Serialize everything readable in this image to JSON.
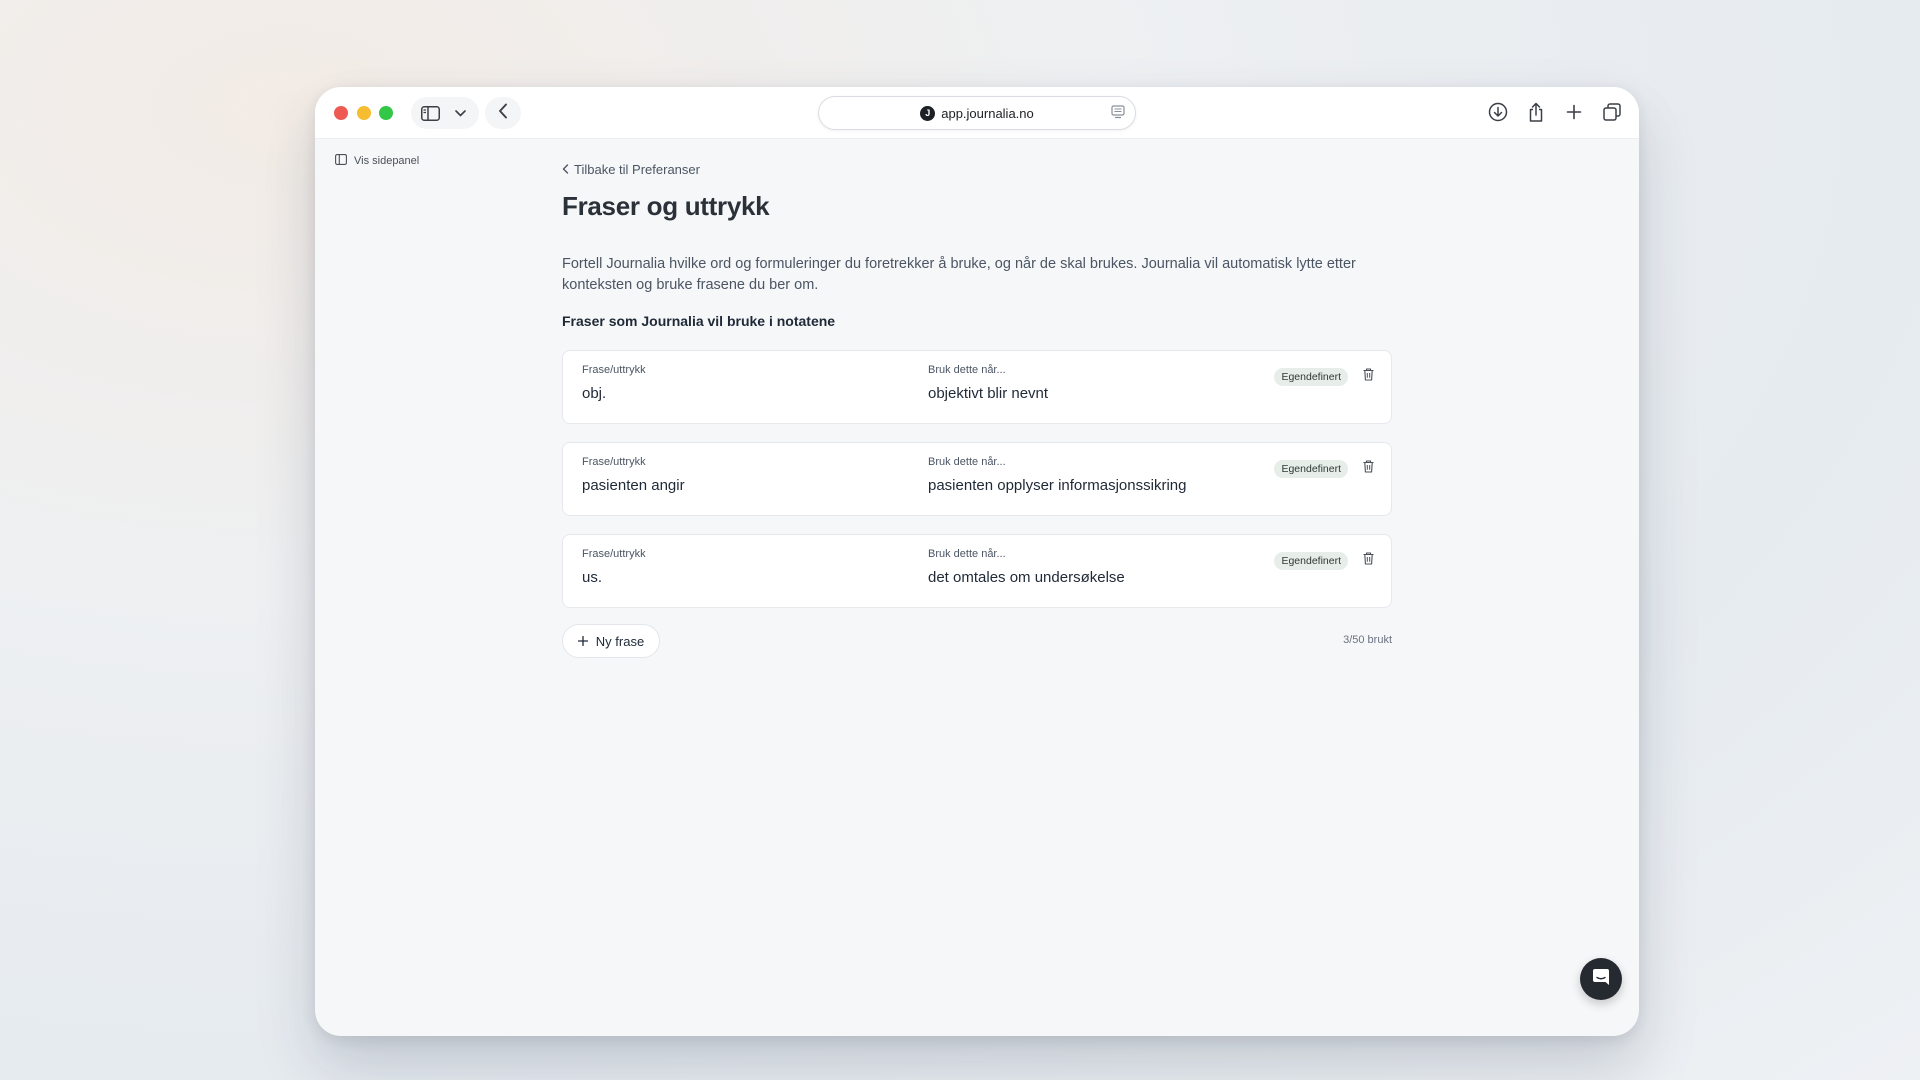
{
  "browser": {
    "url": "app.journalia.no",
    "favicon_letter": "J"
  },
  "sidebar_toggle": {
    "label": "Vis sidepanel"
  },
  "page": {
    "back_label": "Tilbake til Preferanser",
    "title": "Fraser og uttrykk",
    "description": "Fortell Journalia hvilke ord og formuleringer du foretrekker å bruke, og når de skal brukes. Journalia vil automatisk lytte etter konteksten og bruke frasene du ber om.",
    "section_heading": "Fraser som Journalia vil bruke i notatene"
  },
  "phrases": [
    {
      "phrase_label": "Frase/uttrykk",
      "phrase": "obj.",
      "when_label": "Bruk dette når...",
      "when": "objektivt blir nevnt",
      "badge": "Egendefinert"
    },
    {
      "phrase_label": "Frase/uttrykk",
      "phrase": "pasienten angir",
      "when_label": "Bruk dette når...",
      "when": "pasienten opplyser informasjonssikring",
      "badge": "Egendefinert"
    },
    {
      "phrase_label": "Frase/uttrykk",
      "phrase": "us.",
      "when_label": "Bruk dette når...",
      "when": "det omtales om undersøkelse",
      "badge": "Egendefinert"
    }
  ],
  "actions": {
    "new_phrase_label": "Ny frase",
    "usage": "3/50 brukt"
  },
  "icons": {
    "sidebar": "sidebar-icon",
    "chevron_down": "chevron-down-icon",
    "back": "chevron-left-icon",
    "reader": "reader-icon",
    "download": "download-icon",
    "share": "share-icon",
    "new_tab": "plus-icon",
    "tabs": "tabs-overview-icon",
    "trash": "trash-icon",
    "chat": "chat-icon"
  },
  "colors": {
    "traffic_red": "#ee5a52",
    "traffic_yellow": "#f5bd2f",
    "traffic_green": "#33c748",
    "badge_bg": "#e7ede8",
    "fab_bg": "#252a31"
  }
}
